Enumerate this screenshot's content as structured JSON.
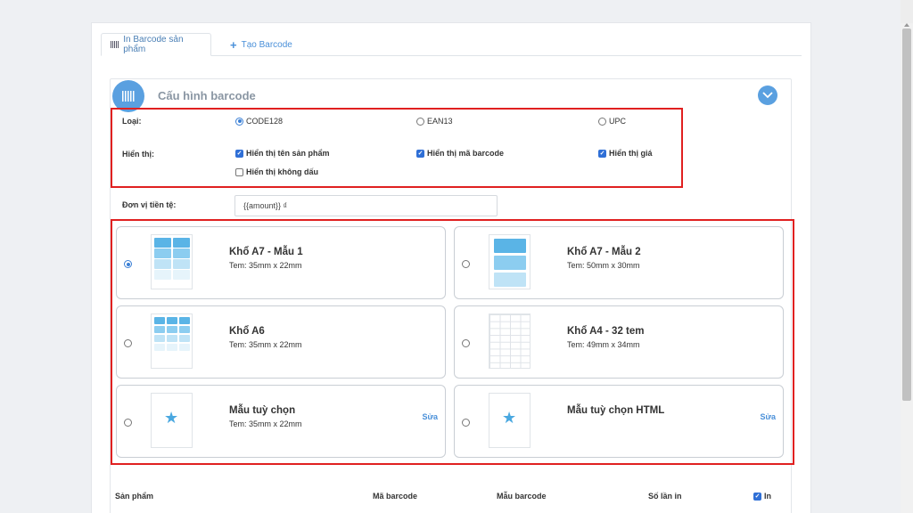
{
  "tabs": [
    {
      "label": "In Barcode sản phẩm",
      "icon": "barcode-icon"
    },
    {
      "label": "Tạo Barcode",
      "icon": "plus-icon"
    }
  ],
  "card": {
    "title": "Cấu hình barcode"
  },
  "options": {
    "type_label": "Loại:",
    "types": [
      {
        "label": "CODE128",
        "selected": true
      },
      {
        "label": "EAN13",
        "selected": false
      },
      {
        "label": "UPC",
        "selected": false
      }
    ],
    "display_label": "Hiển thị:",
    "display": [
      {
        "label": "Hiển thị tên sản phẩm",
        "checked": true
      },
      {
        "label": "Hiển thị mã barcode",
        "checked": true
      },
      {
        "label": "Hiển thị giá",
        "checked": true
      },
      {
        "label": "Hiển thị không dấu",
        "checked": false
      }
    ]
  },
  "currency": {
    "label": "Đơn vị tiền tệ:",
    "value": "{{amount}} ₫"
  },
  "templates": [
    {
      "title": "Khổ A7 - Mẫu 1",
      "subtitle": "Tem: 35mm x 22mm",
      "selected": true
    },
    {
      "title": "Khổ A7 - Mẫu 2",
      "subtitle": "Tem: 50mm x 30mm",
      "selected": false
    },
    {
      "title": "Khổ A6",
      "subtitle": "Tem: 35mm x 22mm",
      "selected": false
    },
    {
      "title": "Khổ A4 - 32 tem",
      "subtitle": "Tem: 49mm x 34mm",
      "selected": false
    },
    {
      "title": "Mẫu tuỳ chọn",
      "subtitle": "Tem: 35mm x 22mm",
      "edit": "Sửa",
      "selected": false
    },
    {
      "title": "Mẫu tuỳ chọn HTML",
      "subtitle": "",
      "edit": "Sửa",
      "selected": false
    }
  ],
  "table": {
    "columns": [
      "Sản phẩm",
      "Mã barcode",
      "Mẫu barcode",
      "Số lần in",
      "In"
    ],
    "print_all_checked": true
  },
  "colors": {
    "accent": "#5aa0e0",
    "highlight_border": "#e02020",
    "link": "#4a90d9"
  }
}
